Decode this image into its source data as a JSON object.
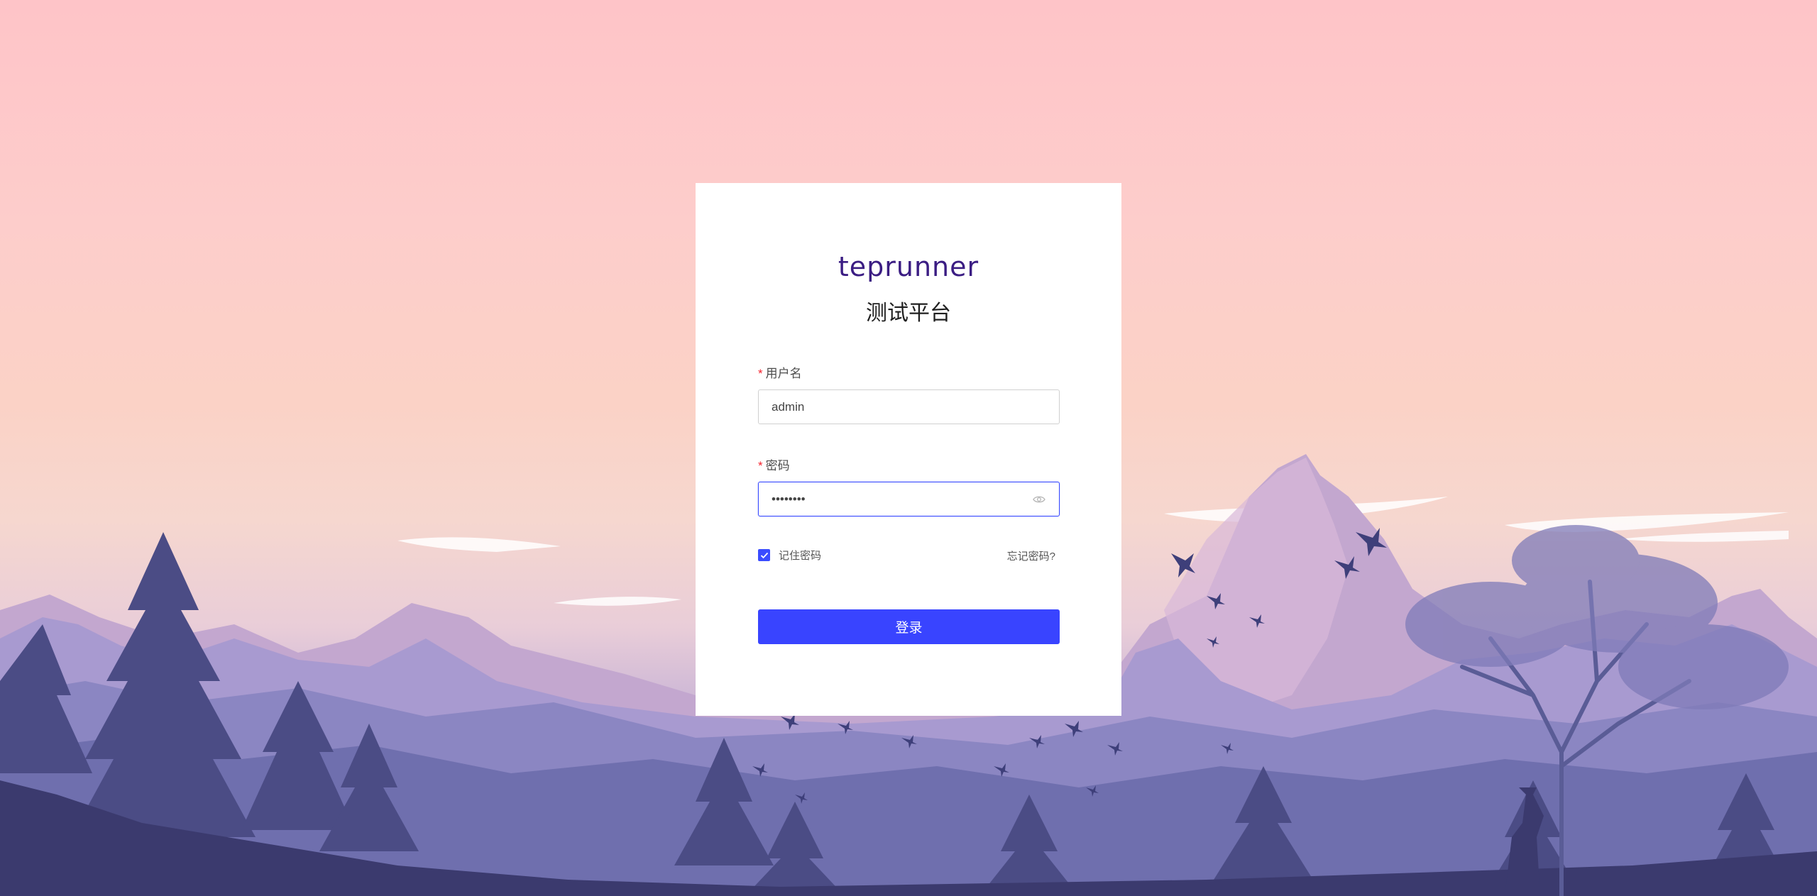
{
  "brand": {
    "logo_text": "teprunner",
    "subtitle": "测试平台",
    "logo_color": "#3b1d83"
  },
  "form": {
    "username": {
      "label": "用户名",
      "required_mark": "*",
      "value": "admin"
    },
    "password": {
      "label": "密码",
      "required_mark": "*",
      "value": "••••••••",
      "toggle_icon": "eye-icon"
    },
    "remember": {
      "label": "记住密码",
      "checked": true
    },
    "forgot_link": "忘记密码?",
    "submit_label": "登录"
  },
  "colors": {
    "accent": "#3944ff",
    "required": "#f5222d"
  },
  "background": {
    "description_icon": "mountain-landscape-illustration"
  }
}
